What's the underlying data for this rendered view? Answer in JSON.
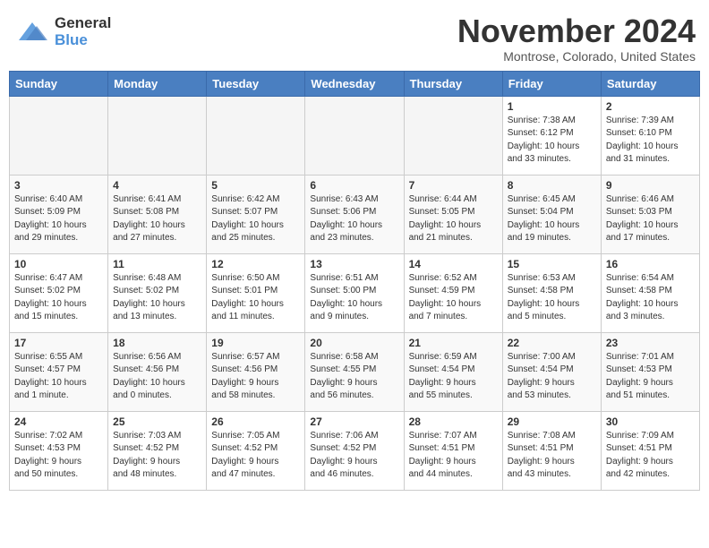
{
  "header": {
    "logo_general": "General",
    "logo_blue": "Blue",
    "month_title": "November 2024",
    "location": "Montrose, Colorado, United States"
  },
  "weekdays": [
    "Sunday",
    "Monday",
    "Tuesday",
    "Wednesday",
    "Thursday",
    "Friday",
    "Saturday"
  ],
  "weeks": [
    [
      {
        "day": "",
        "info": ""
      },
      {
        "day": "",
        "info": ""
      },
      {
        "day": "",
        "info": ""
      },
      {
        "day": "",
        "info": ""
      },
      {
        "day": "",
        "info": ""
      },
      {
        "day": "1",
        "info": "Sunrise: 7:38 AM\nSunset: 6:12 PM\nDaylight: 10 hours\nand 33 minutes."
      },
      {
        "day": "2",
        "info": "Sunrise: 7:39 AM\nSunset: 6:10 PM\nDaylight: 10 hours\nand 31 minutes."
      }
    ],
    [
      {
        "day": "3",
        "info": "Sunrise: 6:40 AM\nSunset: 5:09 PM\nDaylight: 10 hours\nand 29 minutes."
      },
      {
        "day": "4",
        "info": "Sunrise: 6:41 AM\nSunset: 5:08 PM\nDaylight: 10 hours\nand 27 minutes."
      },
      {
        "day": "5",
        "info": "Sunrise: 6:42 AM\nSunset: 5:07 PM\nDaylight: 10 hours\nand 25 minutes."
      },
      {
        "day": "6",
        "info": "Sunrise: 6:43 AM\nSunset: 5:06 PM\nDaylight: 10 hours\nand 23 minutes."
      },
      {
        "day": "7",
        "info": "Sunrise: 6:44 AM\nSunset: 5:05 PM\nDaylight: 10 hours\nand 21 minutes."
      },
      {
        "day": "8",
        "info": "Sunrise: 6:45 AM\nSunset: 5:04 PM\nDaylight: 10 hours\nand 19 minutes."
      },
      {
        "day": "9",
        "info": "Sunrise: 6:46 AM\nSunset: 5:03 PM\nDaylight: 10 hours\nand 17 minutes."
      }
    ],
    [
      {
        "day": "10",
        "info": "Sunrise: 6:47 AM\nSunset: 5:02 PM\nDaylight: 10 hours\nand 15 minutes."
      },
      {
        "day": "11",
        "info": "Sunrise: 6:48 AM\nSunset: 5:02 PM\nDaylight: 10 hours\nand 13 minutes."
      },
      {
        "day": "12",
        "info": "Sunrise: 6:50 AM\nSunset: 5:01 PM\nDaylight: 10 hours\nand 11 minutes."
      },
      {
        "day": "13",
        "info": "Sunrise: 6:51 AM\nSunset: 5:00 PM\nDaylight: 10 hours\nand 9 minutes."
      },
      {
        "day": "14",
        "info": "Sunrise: 6:52 AM\nSunset: 4:59 PM\nDaylight: 10 hours\nand 7 minutes."
      },
      {
        "day": "15",
        "info": "Sunrise: 6:53 AM\nSunset: 4:58 PM\nDaylight: 10 hours\nand 5 minutes."
      },
      {
        "day": "16",
        "info": "Sunrise: 6:54 AM\nSunset: 4:58 PM\nDaylight: 10 hours\nand 3 minutes."
      }
    ],
    [
      {
        "day": "17",
        "info": "Sunrise: 6:55 AM\nSunset: 4:57 PM\nDaylight: 10 hours\nand 1 minute."
      },
      {
        "day": "18",
        "info": "Sunrise: 6:56 AM\nSunset: 4:56 PM\nDaylight: 10 hours\nand 0 minutes."
      },
      {
        "day": "19",
        "info": "Sunrise: 6:57 AM\nSunset: 4:56 PM\nDaylight: 9 hours\nand 58 minutes."
      },
      {
        "day": "20",
        "info": "Sunrise: 6:58 AM\nSunset: 4:55 PM\nDaylight: 9 hours\nand 56 minutes."
      },
      {
        "day": "21",
        "info": "Sunrise: 6:59 AM\nSunset: 4:54 PM\nDaylight: 9 hours\nand 55 minutes."
      },
      {
        "day": "22",
        "info": "Sunrise: 7:00 AM\nSunset: 4:54 PM\nDaylight: 9 hours\nand 53 minutes."
      },
      {
        "day": "23",
        "info": "Sunrise: 7:01 AM\nSunset: 4:53 PM\nDaylight: 9 hours\nand 51 minutes."
      }
    ],
    [
      {
        "day": "24",
        "info": "Sunrise: 7:02 AM\nSunset: 4:53 PM\nDaylight: 9 hours\nand 50 minutes."
      },
      {
        "day": "25",
        "info": "Sunrise: 7:03 AM\nSunset: 4:52 PM\nDaylight: 9 hours\nand 48 minutes."
      },
      {
        "day": "26",
        "info": "Sunrise: 7:05 AM\nSunset: 4:52 PM\nDaylight: 9 hours\nand 47 minutes."
      },
      {
        "day": "27",
        "info": "Sunrise: 7:06 AM\nSunset: 4:52 PM\nDaylight: 9 hours\nand 46 minutes."
      },
      {
        "day": "28",
        "info": "Sunrise: 7:07 AM\nSunset: 4:51 PM\nDaylight: 9 hours\nand 44 minutes."
      },
      {
        "day": "29",
        "info": "Sunrise: 7:08 AM\nSunset: 4:51 PM\nDaylight: 9 hours\nand 43 minutes."
      },
      {
        "day": "30",
        "info": "Sunrise: 7:09 AM\nSunset: 4:51 PM\nDaylight: 9 hours\nand 42 minutes."
      }
    ]
  ]
}
